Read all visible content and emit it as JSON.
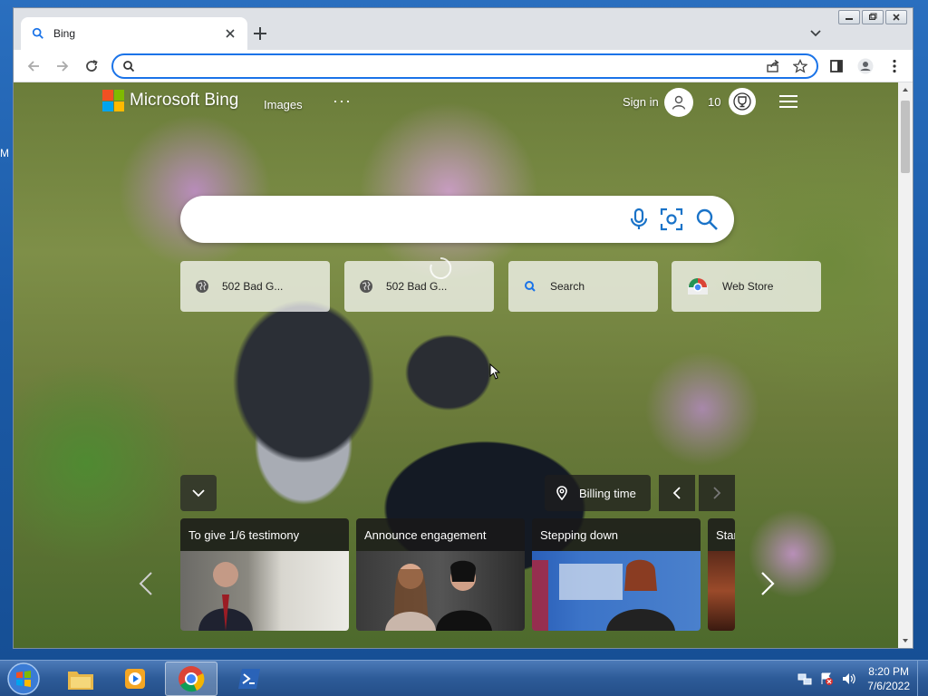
{
  "desktop": {
    "stub_text": "M"
  },
  "browser": {
    "tab": {
      "title": "Bing"
    },
    "omnibox": {
      "value": "",
      "placeholder": ""
    }
  },
  "bing": {
    "logo_text": "Microsoft Bing",
    "nav": {
      "images": "Images",
      "more": "···"
    },
    "sign_in": "Sign in",
    "reward_count": "10",
    "search": {
      "value": "",
      "placeholder": ""
    },
    "quick_links": [
      {
        "label": "502 Bad G...",
        "icon": "globe-icon"
      },
      {
        "label": "502 Bad G...",
        "icon": "globe-icon"
      },
      {
        "label": "Search",
        "icon": "search-icon"
      },
      {
        "label": "Web Store",
        "icon": "chrome-web-store-icon"
      }
    ],
    "billing_time": "Billing time",
    "news": [
      {
        "title": "To give 1/6 testimony"
      },
      {
        "title": "Announce engagement"
      },
      {
        "title": "Stepping down"
      },
      {
        "title": "Star"
      }
    ]
  },
  "taskbar": {
    "time": "8:20 PM",
    "date": "7/6/2022"
  },
  "colors": {
    "accent": "#1a73e8",
    "ms_red": "#f25022",
    "ms_green": "#7fba00",
    "ms_blue": "#00a4ef",
    "ms_yellow": "#ffb900"
  }
}
